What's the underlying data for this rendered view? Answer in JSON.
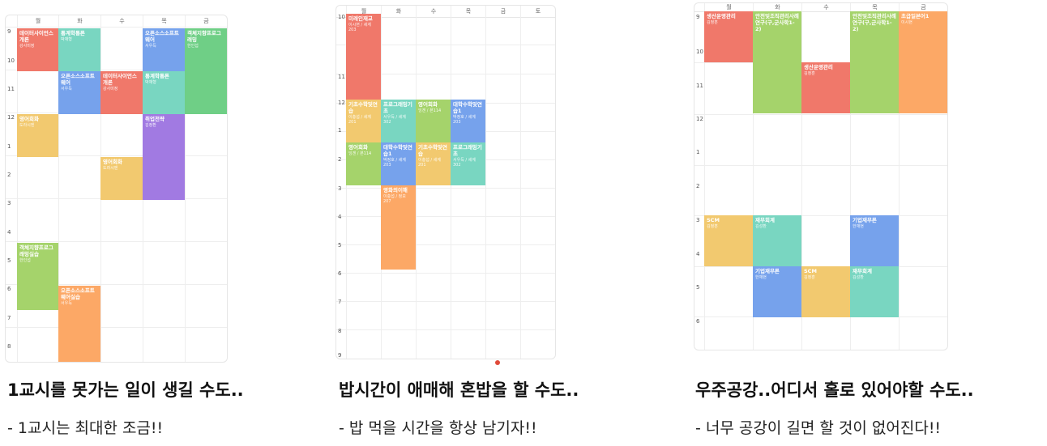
{
  "colors": {
    "red": "#f0786a",
    "teal": "#79d6c1",
    "blue": "#76a2ec",
    "green": "#a5d36b",
    "yellow": "#f2c96f",
    "orange": "#fca866",
    "purple": "#a17ae2",
    "mint": "#6fcf86"
  },
  "panels": [
    {
      "days": [
        "월",
        "화",
        "수",
        "목",
        "금"
      ],
      "periods": [
        "9",
        "10",
        "11",
        "12",
        "1",
        "2",
        "3",
        "4",
        "5",
        "6",
        "7",
        "8"
      ],
      "events": [
        {
          "title": "데이터사이언스개론",
          "sub": "강사미정",
          "color": "red"
        },
        {
          "title": "통계학통론",
          "sub": "박재형",
          "color": "teal"
        },
        {
          "title": "오픈소스소프트웨어",
          "sub": "서우득",
          "color": "blue"
        },
        {
          "title": "객체지향프로그래밍",
          "sub": "한인섭",
          "color": "mint"
        },
        {
          "title": "오픈소스소프트웨어",
          "sub": "서우득",
          "color": "blue"
        },
        {
          "title": "데이터사이언스개론",
          "sub": "강사미정",
          "color": "red"
        },
        {
          "title": "통계학통론",
          "sub": "박재형",
          "color": "teal"
        },
        {
          "title": "영어회화",
          "sub": "도라시엔",
          "color": "yellow"
        },
        {
          "title": "취업전략",
          "sub": "김정환",
          "color": "purple"
        },
        {
          "title": "영어회화",
          "sub": "도라시엔",
          "color": "yellow"
        },
        {
          "title": "객체지향프로그래밍실습",
          "sub": "한인섭",
          "color": "green"
        },
        {
          "title": "오픈소스소프트웨어실습",
          "sub": "서우득",
          "color": "orange"
        }
      ],
      "heading": "1교시를 못가는 일이 생길 수도..",
      "tip": "- 1교시는 최대한 조금!!"
    },
    {
      "days": [
        "월",
        "화",
        "수",
        "목",
        "금",
        "토"
      ],
      "periods": [
        "10",
        "11",
        "12",
        "1",
        "2",
        "3",
        "4",
        "5",
        "6",
        "7",
        "8",
        "9"
      ],
      "events": [
        {
          "title": "미래인재교",
          "sub": "이시현 / 세계203",
          "color": "red"
        },
        {
          "title": "기초수학및연습",
          "sub": "이충섭 / 세계201",
          "color": "yellow"
        },
        {
          "title": "프로그래밍기초",
          "sub": "서우득 / 세계302",
          "color": "teal"
        },
        {
          "title": "영어회화",
          "sub": "잉겐 / 본114",
          "color": "green"
        },
        {
          "title": "대학수학및연습1",
          "sub": "박정호 / 세계203",
          "color": "blue"
        },
        {
          "title": "영어회화",
          "sub": "잉겐 / 본114",
          "color": "green"
        },
        {
          "title": "대학수학및연습1",
          "sub": "박정호 / 세계203",
          "color": "blue"
        },
        {
          "title": "기초수학및연습",
          "sub": "이충섭 / 세계201",
          "color": "yellow"
        },
        {
          "title": "프로그래밍기초",
          "sub": "서우득 / 세계302",
          "color": "teal"
        },
        {
          "title": "영화의이해",
          "sub": "이충섭 / 정보207",
          "color": "orange"
        }
      ],
      "heading": "밥시간이 애매해 혼밥을 할 수도..",
      "tip": "- 밥 먹을 시간을 항상 남기자!!"
    },
    {
      "days": [
        "월",
        "화",
        "수",
        "목",
        "금"
      ],
      "periods": [
        "9",
        "10",
        "11",
        "12",
        "1",
        "2",
        "3",
        "4",
        "5",
        "6"
      ],
      "events": [
        {
          "title": "생산운영관리",
          "sub": "김정훈",
          "color": "red"
        },
        {
          "title": "안전및조직관리사례연구(구,군사학1-2)",
          "sub": "",
          "color": "green"
        },
        {
          "title": "안전및조직관리사례연구(구,군사학1-2)",
          "sub": "",
          "color": "green"
        },
        {
          "title": "초급일본어1",
          "sub": "이시현",
          "color": "orange"
        },
        {
          "title": "생산운영관리",
          "sub": "김정훈",
          "color": "red"
        },
        {
          "title": "SCM",
          "sub": "김정훈",
          "color": "yellow"
        },
        {
          "title": "재무회계",
          "sub": "김성환",
          "color": "teal"
        },
        {
          "title": "기업재무론",
          "sub": "한재현",
          "color": "blue"
        },
        {
          "title": "기업재무론",
          "sub": "한재현",
          "color": "blue"
        },
        {
          "title": "SCM",
          "sub": "김정훈",
          "color": "yellow"
        },
        {
          "title": "재무회계",
          "sub": "김성환",
          "color": "teal"
        }
      ],
      "heading": "우주공강..어디서 홀로 있어야할 수도..",
      "tip": "- 너무 공강이 길면 할 것이 없어진다!!"
    }
  ]
}
